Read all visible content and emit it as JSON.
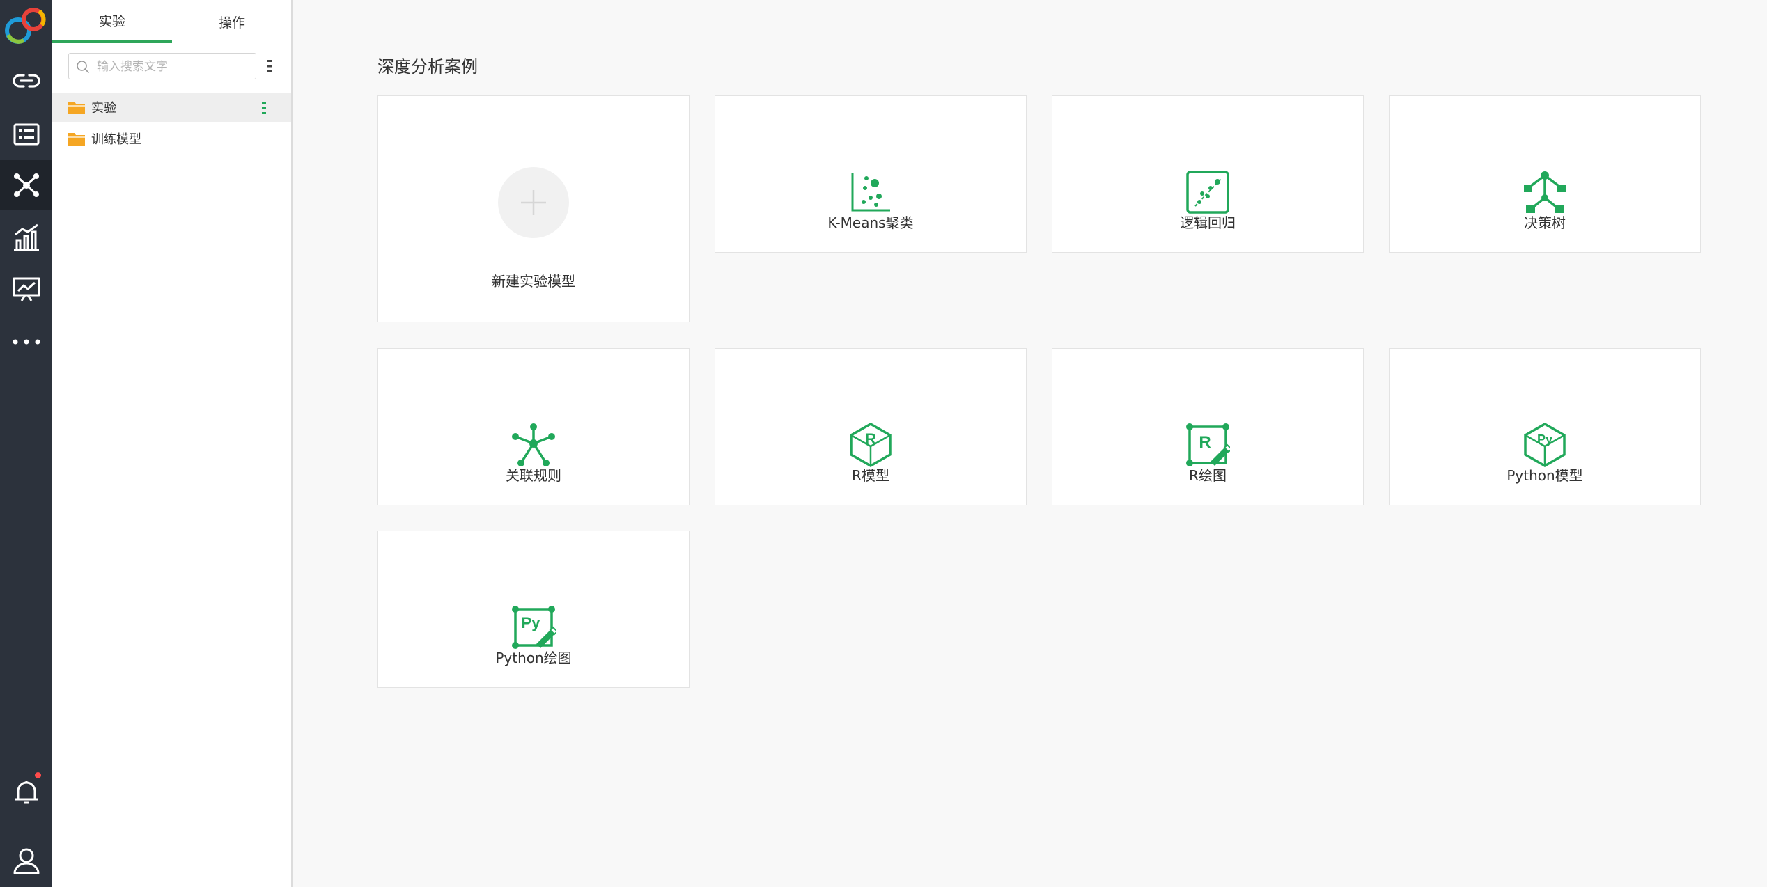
{
  "panel": {
    "tabs": [
      "实验",
      "操作"
    ],
    "search": {
      "placeholder": "输入搜索文字",
      "value": ""
    },
    "tree": [
      {
        "label": "实验",
        "selected": true
      },
      {
        "label": "训练模型",
        "selected": false
      }
    ]
  },
  "main": {
    "section_title": "深度分析案例",
    "new_card_label": "新建实验模型",
    "cards": [
      {
        "label": "K-Means聚类",
        "icon": "kmeans-icon"
      },
      {
        "label": "逻辑回归",
        "icon": "logistic-regression-icon"
      },
      {
        "label": "决策树",
        "icon": "decision-tree-icon"
      },
      {
        "label": "关联规则",
        "icon": "association-rules-icon"
      },
      {
        "label": "R模型",
        "icon": "r-model-icon"
      },
      {
        "label": "R绘图",
        "icon": "r-plot-icon"
      },
      {
        "label": "Python模型",
        "icon": "python-model-icon"
      },
      {
        "label": "Python绘图",
        "icon": "python-plot-icon"
      }
    ]
  },
  "colors": {
    "accent": "#21a85a",
    "rail": "#2c323c",
    "folder": "#f5a623",
    "badge": "#ff4b4b"
  }
}
